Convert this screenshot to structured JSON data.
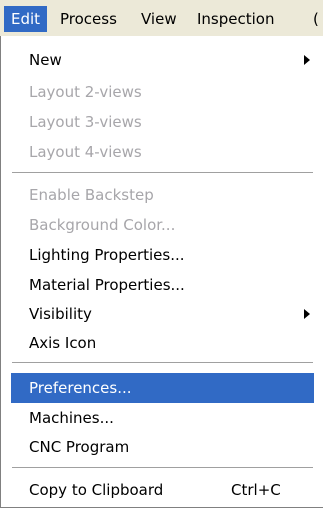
{
  "menubar": {
    "items": [
      {
        "label": "Edit",
        "active": true
      },
      {
        "label": "Process"
      },
      {
        "label": "View"
      },
      {
        "label": "Inspection"
      },
      {
        "label": "("
      }
    ]
  },
  "edit_menu": {
    "items": [
      {
        "label": "New",
        "submenu": true
      },
      {
        "label": "Layout 2-views",
        "disabled": true
      },
      {
        "label": "Layout 3-views",
        "disabled": true
      },
      {
        "label": "Layout 4-views",
        "disabled": true
      },
      {
        "label": "Enable Backstep",
        "disabled": true
      },
      {
        "label": "Background Color...",
        "disabled": true
      },
      {
        "label": "Lighting Properties..."
      },
      {
        "label": "Material Properties..."
      },
      {
        "label": "Visibility",
        "submenu": true
      },
      {
        "label": "Axis Icon"
      },
      {
        "label": "Preferences...",
        "highlighted": true
      },
      {
        "label": "Machines..."
      },
      {
        "label": "CNC Program"
      },
      {
        "label": "Copy to Clipboard",
        "shortcut": "Ctrl+C"
      }
    ]
  },
  "colors": {
    "highlight": "#316ac5",
    "menubar_bg": "#ece9d8",
    "disabled_text": "#a7a6aa"
  }
}
